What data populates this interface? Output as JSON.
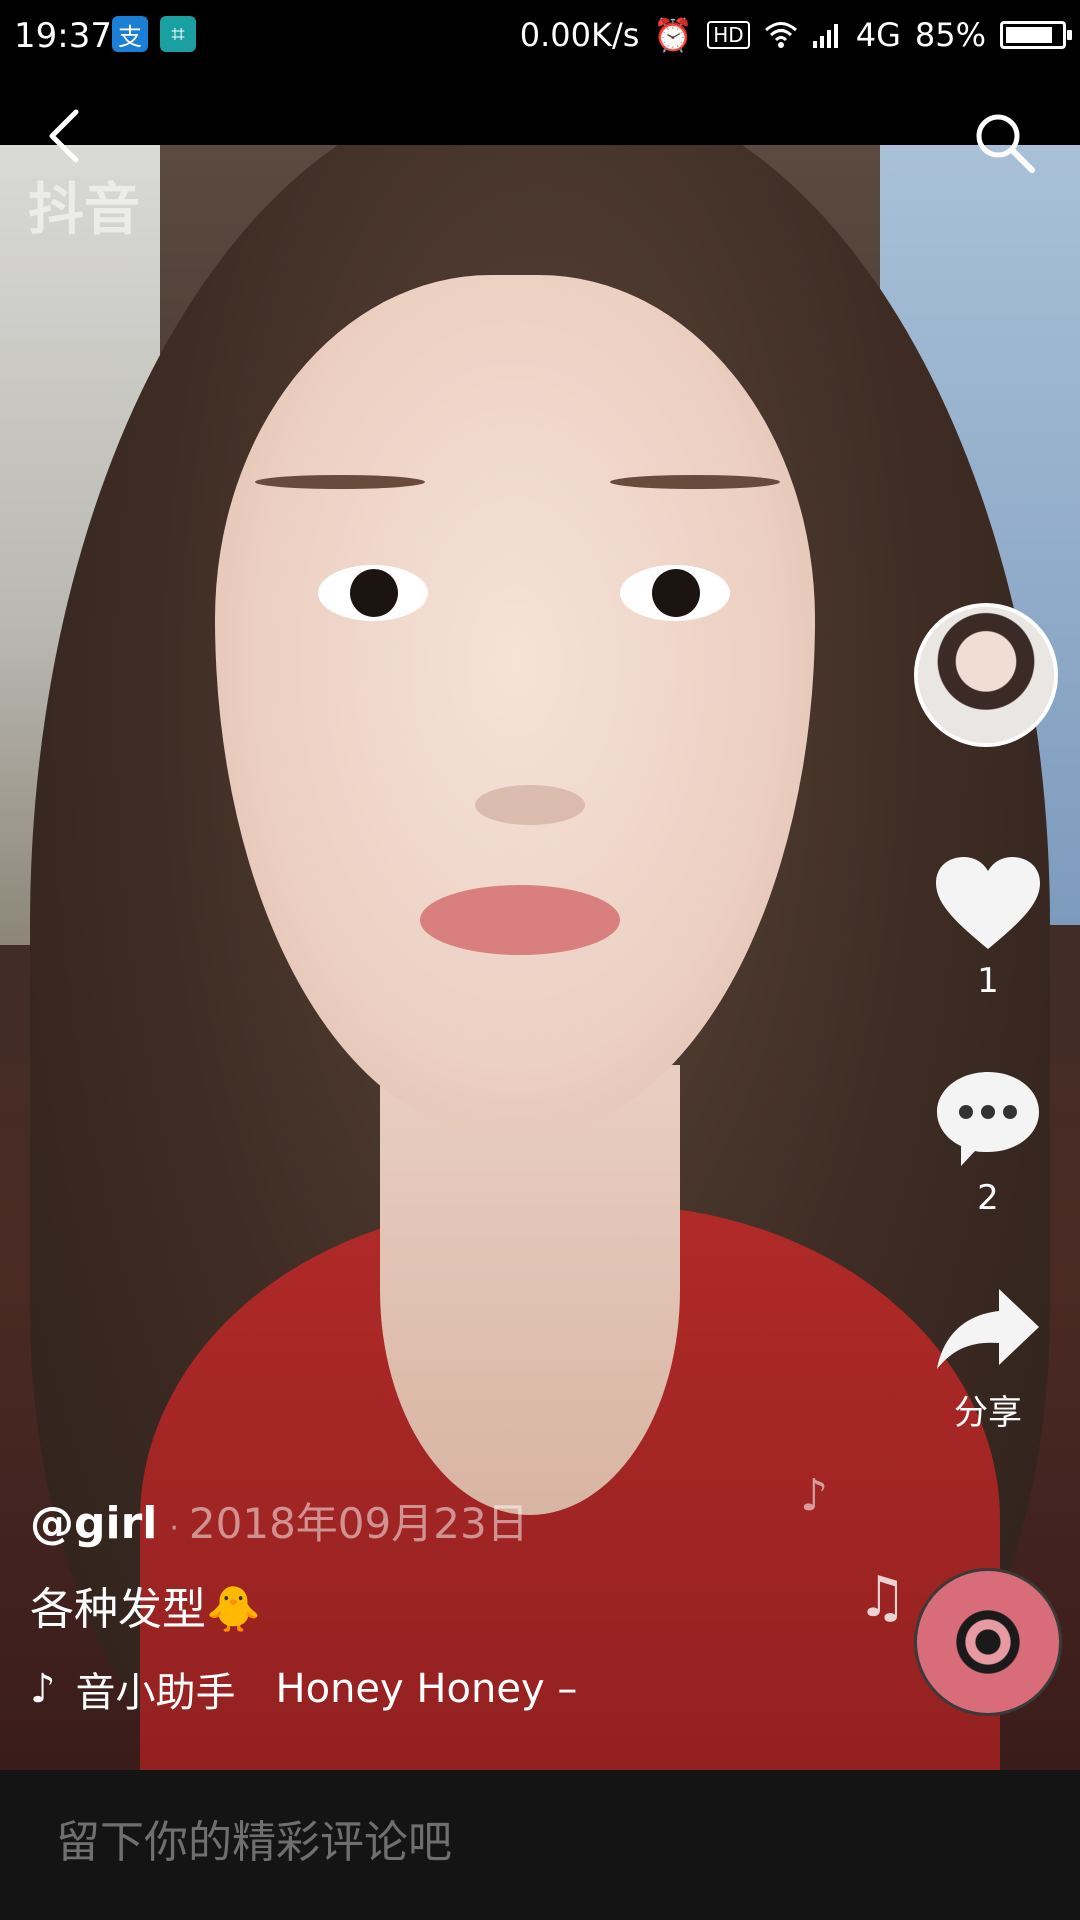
{
  "status_bar": {
    "time": "19:37",
    "app_icons": [
      {
        "name": "alipay-icon",
        "glyph": "支",
        "color": "#1b7fd6"
      },
      {
        "name": "scan-icon",
        "glyph": "⌗",
        "color": "#1aa0a0"
      }
    ],
    "net_speed": "0.00K/s",
    "network": "4G",
    "battery_text": "85%",
    "battery_level": 0.85
  },
  "video": {
    "watermark": "抖音"
  },
  "actions": {
    "like_count": "1",
    "comment_count": "2",
    "share_label": "分享"
  },
  "caption": {
    "author": "@girl",
    "date": "2018年09月23日",
    "description": "各种发型🐥"
  },
  "music": {
    "creator": "音小助手",
    "title": "Honey Honey –"
  },
  "comment_bar": {
    "placeholder": "留下你的精彩评论吧"
  },
  "colors": {
    "background": "#000000",
    "comment_bar": "#141414",
    "placeholder": "#6f6f6f"
  }
}
